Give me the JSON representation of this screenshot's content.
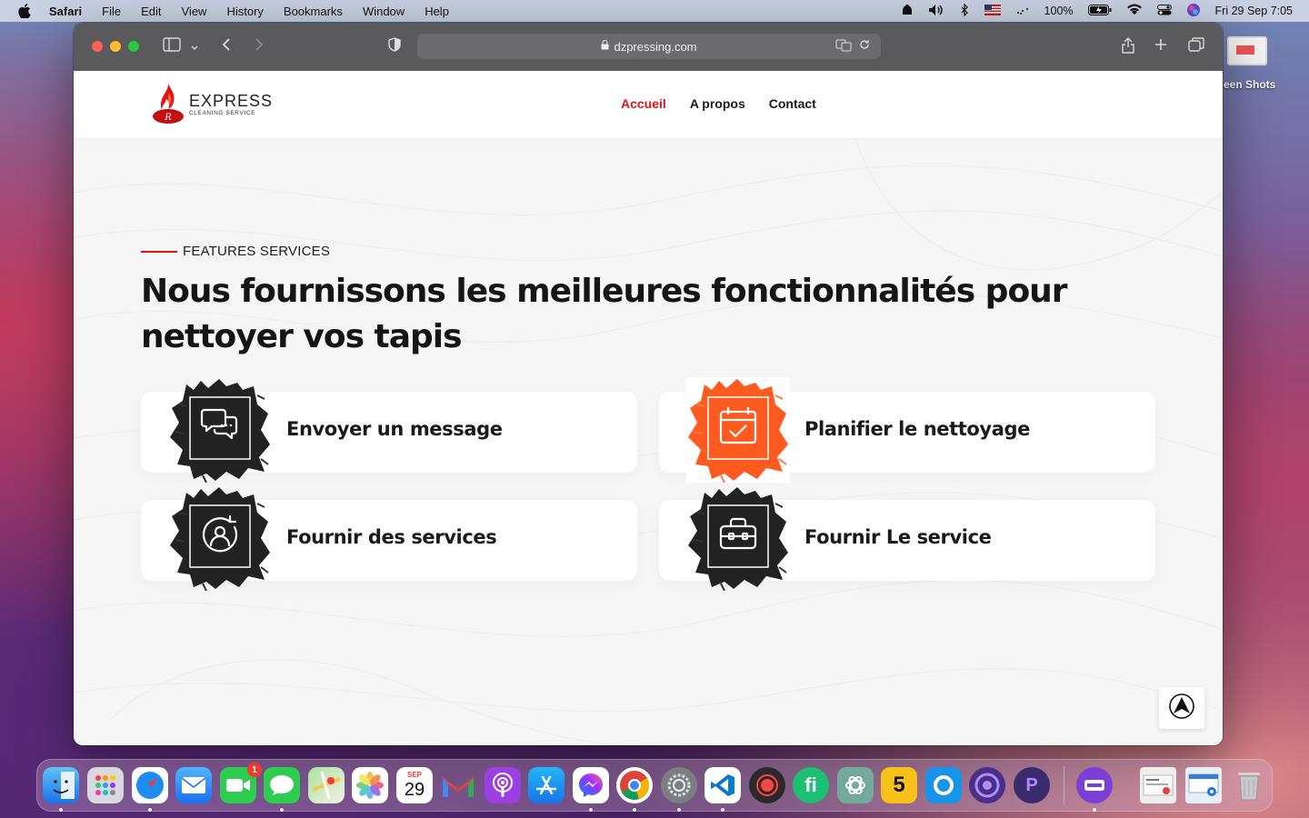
{
  "menubar": {
    "app_name": "Safari",
    "items": [
      "File",
      "Edit",
      "View",
      "History",
      "Bookmarks",
      "Window",
      "Help"
    ],
    "battery": "100%",
    "datetime": "Fri 29 Sep  7:05"
  },
  "desktop": {
    "screenshots_label": "een Shots"
  },
  "browser": {
    "url": "dzpressing.com"
  },
  "site": {
    "logo_title": "EXPRESS",
    "logo_subtitle": "CLEANING SERVICE",
    "nav": [
      "Accueil",
      "A propos",
      "Contact"
    ],
    "active_nav": "Accueil",
    "accent_color": "#e11212",
    "orange_color": "#ff5a1f",
    "section_tag": "FEATURES SERVICES",
    "headline": "Nous fournissons les meilleures fonctionnalités pour nettoyer vos tapis",
    "cards": [
      {
        "title": "Envoyer un message",
        "icon": "chat-icon",
        "variant": "dark"
      },
      {
        "title": "Planifier le nettoyage",
        "icon": "calendar-check-icon",
        "variant": "orange"
      },
      {
        "title": "Fournir des services",
        "icon": "user-refresh-icon",
        "variant": "dark"
      },
      {
        "title": "Fournir Le service",
        "icon": "toolbox-icon",
        "variant": "dark"
      }
    ]
  },
  "dock": {
    "apps": [
      "Finder",
      "Launchpad",
      "Safari",
      "Mail",
      "FaceTime",
      "Messages",
      "Maps",
      "Photos",
      "Calendar",
      "Gmail",
      "Podcasts",
      "App Store",
      "Messenger",
      "Chrome",
      "System Settings",
      "VS Code",
      "Recorder",
      "Fiverr",
      "ChatGPT",
      "5",
      "Klokki",
      "Proxyman",
      "Plasticity",
      "Storage"
    ],
    "calendar_month": "SEP",
    "calendar_day": "29",
    "facetime_badge": "1"
  }
}
